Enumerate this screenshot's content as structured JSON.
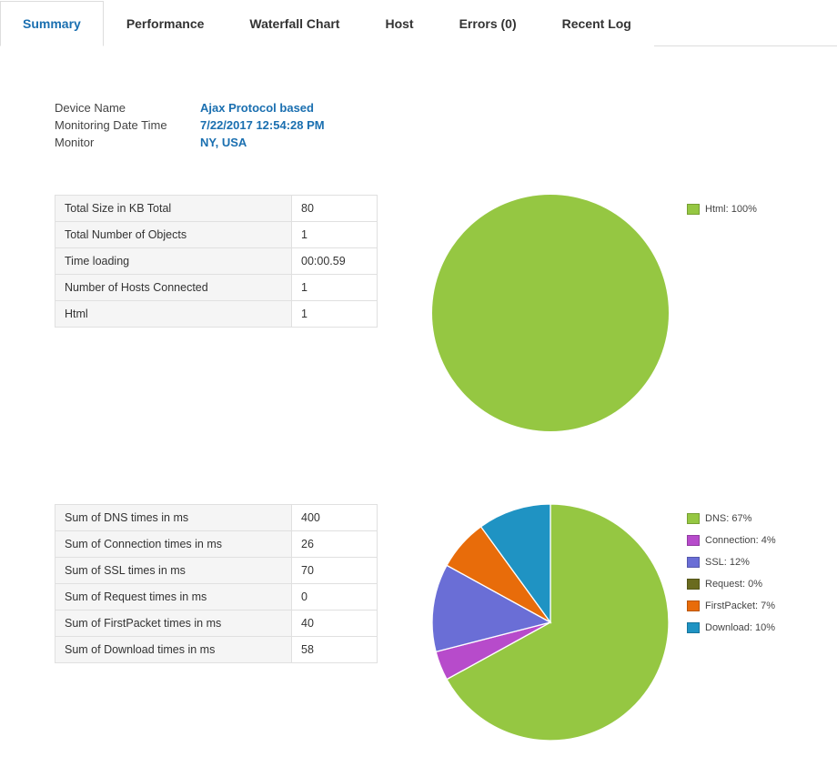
{
  "tabs": {
    "summary": "Summary",
    "performance": "Performance",
    "waterfall": "Waterfall Chart",
    "host": "Host",
    "errors": "Errors (0)",
    "recent_log": "Recent Log"
  },
  "meta": {
    "device_name_label": "Device Name",
    "device_name_value": "Ajax Protocol based",
    "datetime_label": "Monitoring Date Time",
    "datetime_value": "7/22/2017 12:54:28 PM",
    "monitor_label": "Monitor",
    "monitor_value": "NY, USA"
  },
  "table1": {
    "rows": [
      {
        "label": "Total Size in KB Total",
        "value": "80"
      },
      {
        "label": "Total Number of Objects",
        "value": "1"
      },
      {
        "label": "Time loading",
        "value": "00:00.59"
      },
      {
        "label": "Number of Hosts Connected",
        "value": "1"
      },
      {
        "label": "Html",
        "value": "1"
      }
    ]
  },
  "table2": {
    "rows": [
      {
        "label": "Sum of DNS times in ms",
        "value": "400"
      },
      {
        "label": "Sum of Connection times in ms",
        "value": "26"
      },
      {
        "label": "Sum of SSL times in ms",
        "value": "70"
      },
      {
        "label": "Sum of Request times in ms",
        "value": "0"
      },
      {
        "label": "Sum of FirstPacket times in ms",
        "value": "40"
      },
      {
        "label": "Sum of Download times in ms",
        "value": "58"
      }
    ]
  },
  "chart_data": [
    {
      "type": "pie",
      "title": "",
      "series": [
        {
          "name": "Html",
          "value": 100,
          "percent": 100,
          "color": "#95c742"
        }
      ],
      "legend_entries": [
        "Html: 100%"
      ]
    },
    {
      "type": "pie",
      "title": "",
      "series": [
        {
          "name": "DNS",
          "value": 400,
          "percent": 67,
          "color": "#95c742"
        },
        {
          "name": "Connection",
          "value": 26,
          "percent": 4,
          "color": "#b74bcb"
        },
        {
          "name": "SSL",
          "value": 70,
          "percent": 12,
          "color": "#6a6ed6"
        },
        {
          "name": "Request",
          "value": 0,
          "percent": 0,
          "color": "#6a6b1f"
        },
        {
          "name": "FirstPacket",
          "value": 40,
          "percent": 7,
          "color": "#e86c0a"
        },
        {
          "name": "Download",
          "value": 58,
          "percent": 10,
          "color": "#1f93c3"
        }
      ],
      "legend_entries": [
        "DNS: 67%",
        "Connection: 4%",
        "SSL: 12%",
        "Request: 0%",
        "FirstPacket: 7%",
        "Download: 10%"
      ]
    }
  ]
}
